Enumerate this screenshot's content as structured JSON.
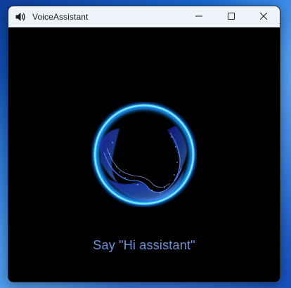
{
  "window": {
    "title": "VoiceAssistant",
    "app_icon": "speaker-icon"
  },
  "caption_buttons": {
    "minimize_icon": "minimize-icon",
    "maximize_icon": "maximize-icon",
    "close_icon": "close-icon"
  },
  "assistant": {
    "prompt": "Say \"Hi assistant\"",
    "orb_icon": "voice-orb-visualizer",
    "accent_color": "#1fb8ff",
    "prompt_color": "#6c93d8"
  }
}
